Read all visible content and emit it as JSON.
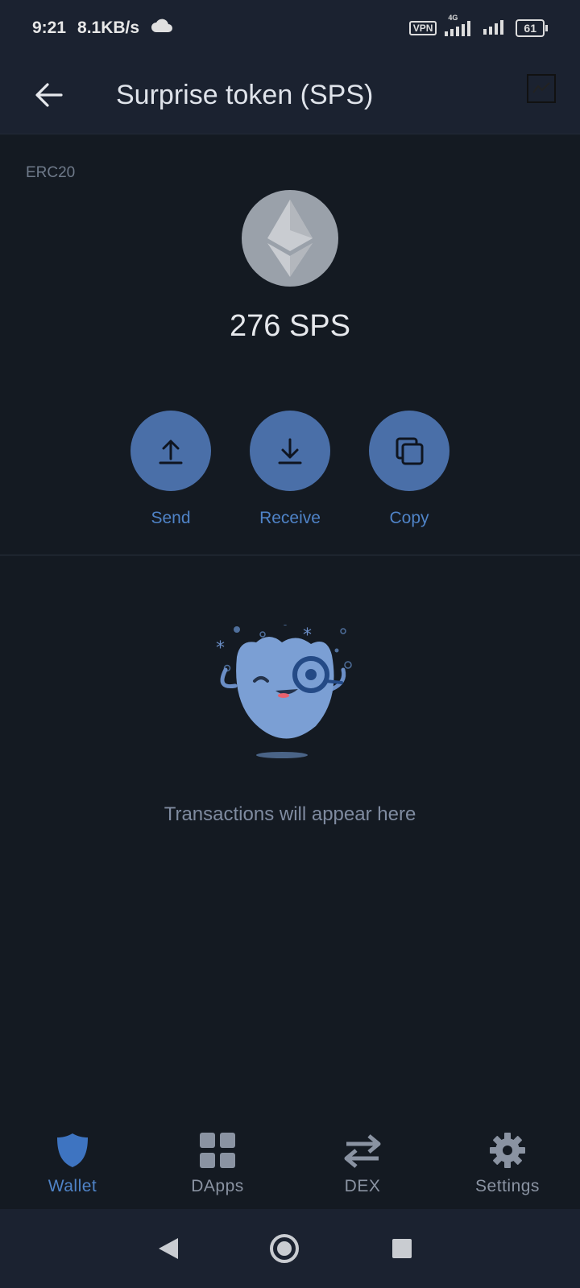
{
  "status": {
    "time": "9:21",
    "speed": "8.1KB/s",
    "vpn": "VPN",
    "network": "4G",
    "battery": "61"
  },
  "appbar": {
    "title": "Surprise token (SPS)",
    "back_icon": "arrow-left-icon",
    "chart_icon": "chart-line-icon"
  },
  "token": {
    "standard": "ERC20",
    "balance": "276 SPS",
    "icon": "ethereum-icon"
  },
  "actions": [
    {
      "label": "Send",
      "icon": "upload-icon"
    },
    {
      "label": "Receive",
      "icon": "download-icon"
    },
    {
      "label": "Copy",
      "icon": "copy-icon"
    }
  ],
  "empty_state": {
    "message": "Transactions will appear here"
  },
  "bottom_nav": [
    {
      "label": "Wallet",
      "icon": "shield-icon",
      "active": true
    },
    {
      "label": "DApps",
      "icon": "grid-icon",
      "active": false
    },
    {
      "label": "DEX",
      "icon": "swap-icon",
      "active": false
    },
    {
      "label": "Settings",
      "icon": "gear-icon",
      "active": false
    }
  ],
  "colors": {
    "accent": "#4f83c7",
    "background": "#141a22",
    "header": "#1b2230",
    "inactive": "#8a93a2"
  }
}
